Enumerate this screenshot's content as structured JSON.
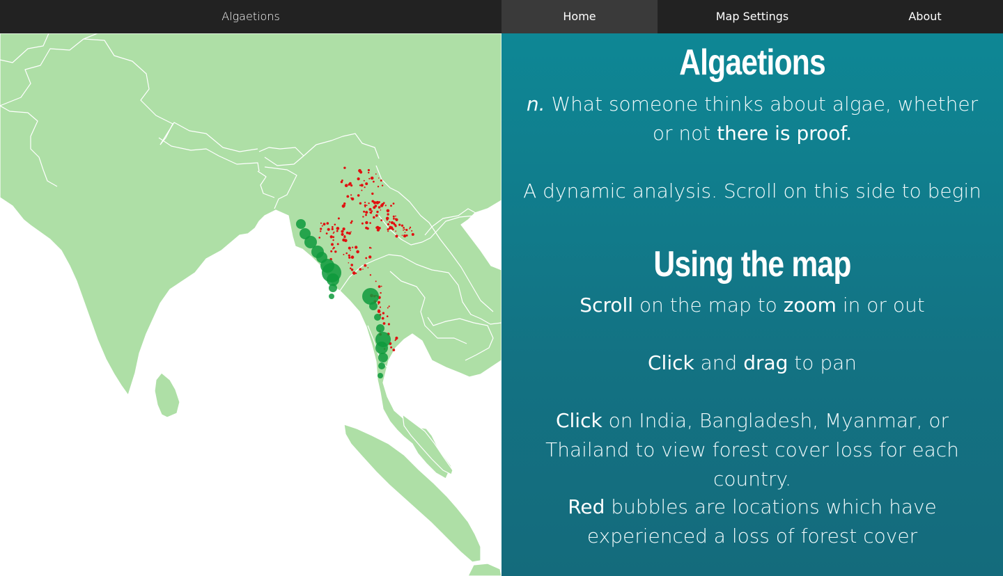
{
  "nav": {
    "brand": "Algaetions",
    "tabs": [
      {
        "label": "Home",
        "active": true
      },
      {
        "label": "Map Settings",
        "active": false
      },
      {
        "label": "About",
        "active": false
      }
    ]
  },
  "map": {
    "land_color": "#aedfa6",
    "border_color": "#ffffff",
    "loss_bubble_color": "#e01010",
    "green_bubble_color": "#0e9a3c"
  },
  "panel": {
    "title": "Algaetions",
    "definition": {
      "pos": "n.",
      "text_1": " What someone thinks about algae, whether or not ",
      "emphasis": "there is proof."
    },
    "intro": "A dynamic analysis. Scroll on this side to begin",
    "usage_heading": "Using the map",
    "scroll_line": {
      "em1": "Scroll",
      "t1": " on the map to ",
      "em2": "zoom",
      "t2": " in or out"
    },
    "drag_line": {
      "em1": "Click",
      "t1": " and ",
      "em2": "drag",
      "t2": " to pan"
    },
    "click_line": {
      "em1": "Click",
      "t1": " on India, Bangladesh, Myanmar, or Thailand to view forest cover loss for each country."
    },
    "red_line": {
      "em1": "Red",
      "t1": " bubbles are locations which have experienced a loss of forest cover"
    }
  }
}
